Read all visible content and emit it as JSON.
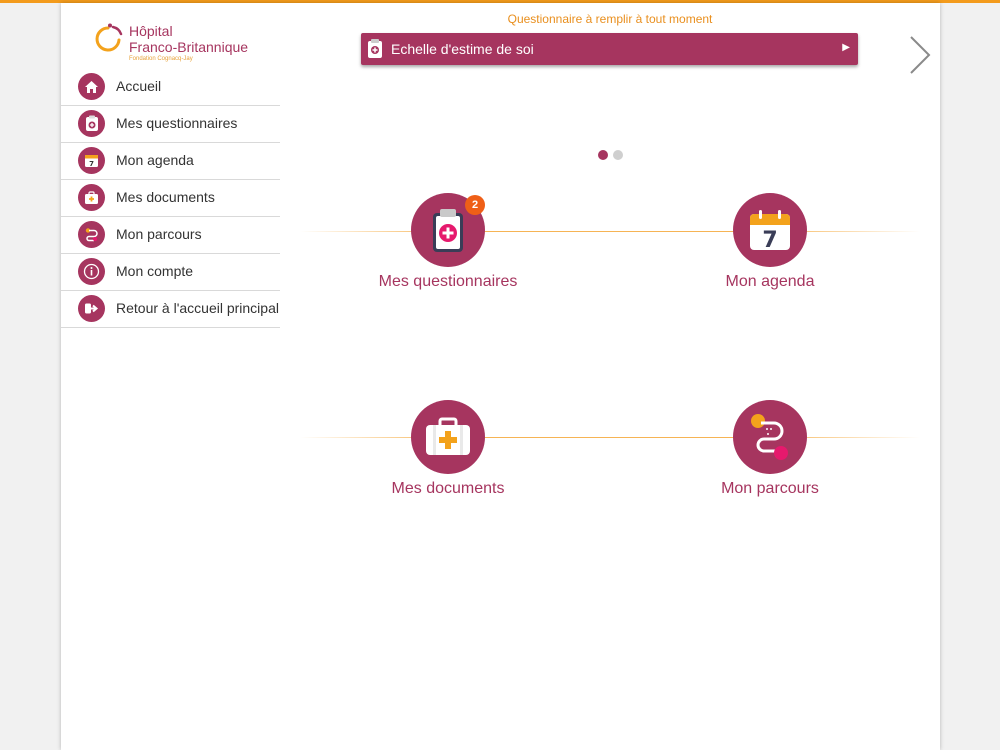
{
  "colors": {
    "brand": "#a6355f",
    "accent": "#f39b1c",
    "badge": "#ef5f17"
  },
  "logo": {
    "line1": "Hôpital",
    "line2": "Franco-Britannique",
    "subtitle": "Fondation Cognacq-Jay"
  },
  "sidebar": {
    "items": [
      {
        "label": "Accueil",
        "icon": "home-icon"
      },
      {
        "label": "Mes questionnaires",
        "icon": "clipboard-icon"
      },
      {
        "label": "Mon agenda",
        "icon": "calendar-icon"
      },
      {
        "label": "Mes documents",
        "icon": "medical-case-icon"
      },
      {
        "label": "Mon parcours",
        "icon": "path-icon"
      },
      {
        "label": "Mon compte",
        "icon": "info-icon"
      },
      {
        "label": "Retour à l'accueil principal",
        "icon": "exit-icon"
      }
    ]
  },
  "quiz_banner": {
    "caption": "Questionnaire à remplir à tout moment",
    "label": "Echelle d'estime de soi",
    "play_glyph": "▶"
  },
  "carousel": {
    "pages": 2,
    "active": 1
  },
  "tiles": [
    {
      "label": "Mes questionnaires",
      "icon": "clipboard-icon",
      "badge": "2"
    },
    {
      "label": "Mon agenda",
      "icon": "calendar-icon",
      "calendar_day": "7"
    },
    {
      "label": "Mes documents",
      "icon": "medical-case-icon"
    },
    {
      "label": "Mon parcours",
      "icon": "path-icon"
    }
  ]
}
